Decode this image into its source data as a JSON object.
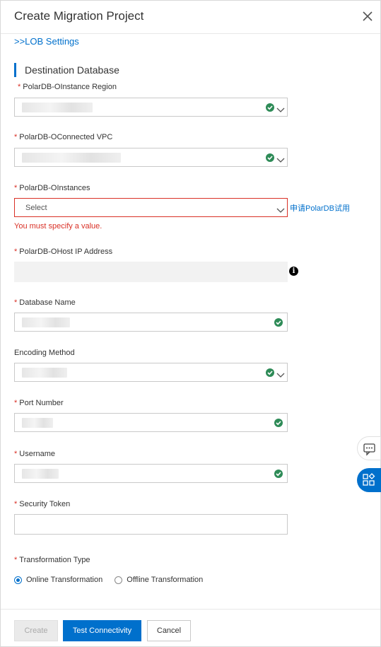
{
  "dialog": {
    "title": "Create Migration Project"
  },
  "lob_link": ">>LOB Settings",
  "section_title": "Destination Database",
  "fields": {
    "region": {
      "label": "PolarDB-OInstance Region"
    },
    "vpc": {
      "label": "PolarDB-OConnected VPC"
    },
    "instances": {
      "label": "PolarDB-OInstances",
      "placeholder": "Select",
      "error": "You must specify a value.",
      "trial_link": "申请PolarDB试用"
    },
    "host": {
      "label": "PolarDB-OHost IP Address"
    },
    "dbname": {
      "label": "Database Name"
    },
    "encoding": {
      "label": "Encoding Method"
    },
    "port": {
      "label": "Port Number"
    },
    "username": {
      "label": "Username"
    },
    "token": {
      "label": "Security Token"
    },
    "transform": {
      "label": "Transformation Type",
      "options": [
        "Online Transformation",
        "Offline Transformation"
      ],
      "selected": "Online Transformation"
    }
  },
  "buttons": {
    "create": "Create",
    "test": "Test Connectivity",
    "cancel": "Cancel"
  },
  "required_mark": "*",
  "colors": {
    "accent": "#0070cc",
    "error": "#d93026",
    "success": "#2e8b57"
  },
  "icons": {
    "close": "close-icon",
    "valid": "check-circle-icon",
    "dropdown": "chevron-down-icon",
    "info": "info-icon",
    "feedback": "chat-icon",
    "apps": "apps-icon"
  }
}
